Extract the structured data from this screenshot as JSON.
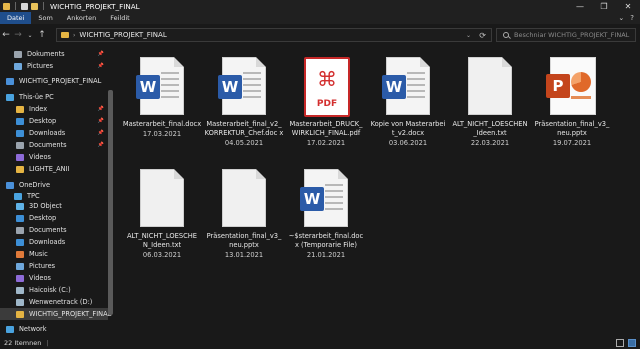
{
  "window": {
    "title": "WICHTIG_PROJEKT_FINAL",
    "minimize": "—",
    "maximize": "❐",
    "close": "✕"
  },
  "ribbon": {
    "tabs": [
      "Datei",
      "Som",
      "Ankorten",
      "Feildit"
    ],
    "help": "?"
  },
  "address": {
    "path": "WICHTIG_PROJEKT_FINAL",
    "search_placeholder": "Beschniar WICHTIG_PROJEKT_FINAL"
  },
  "sidebar": {
    "items": [
      {
        "label": "Dokuments",
        "icon": "documents-icon",
        "color": "#9aa3ad",
        "pinned": true
      },
      {
        "label": "Pictures",
        "icon": "pictures-icon",
        "color": "#6fa8dc",
        "pinned": true
      },
      {
        "label": "WICHTIG_PROJEKT_FINAL",
        "icon": "cloud-icon",
        "color": "#4a90d9",
        "pinned": false
      },
      {
        "label": "This-üe PC",
        "icon": "pc-icon",
        "color": "#4aa3df",
        "pinned": false
      },
      {
        "label": "Index",
        "icon": "folder-icon",
        "color": "#e5b443",
        "pinned": true
      },
      {
        "label": "Desktop",
        "icon": "desktop-icon",
        "color": "#3d8fd6",
        "pinned": true
      },
      {
        "label": "Downloads",
        "icon": "downloads-icon",
        "color": "#3d8fd6",
        "pinned": true
      },
      {
        "label": "Documents",
        "icon": "documents-icon",
        "color": "#9aa3ad",
        "pinned": true
      },
      {
        "label": "Videos",
        "icon": "videos-icon",
        "color": "#8e6bd8",
        "pinned": false
      },
      {
        "label": "LIGHTE_ANII",
        "icon": "folder-icon",
        "color": "#e5b443",
        "pinned": false
      },
      {
        "label": "OneDrive",
        "icon": "cloud-icon",
        "color": "#4a90d9",
        "pinned": false
      },
      {
        "label": "TPC",
        "icon": "pc-icon",
        "color": "#4aa3df",
        "pinned": false
      },
      {
        "label": "3D Object",
        "icon": "3d-object-icon",
        "color": "#5fb3e8",
        "pinned": false
      },
      {
        "label": "Desktop",
        "icon": "desktop-icon",
        "color": "#3d8fd6",
        "pinned": false
      },
      {
        "label": "Documents",
        "icon": "documents-icon",
        "color": "#9aa3ad",
        "pinned": false
      },
      {
        "label": "Downloads",
        "icon": "downloads-icon",
        "color": "#3d8fd6",
        "pinned": false
      },
      {
        "label": "Music",
        "icon": "music-icon",
        "color": "#e07a3a",
        "pinned": false
      },
      {
        "label": "Pictures",
        "icon": "pictures-icon",
        "color": "#6fa8dc",
        "pinned": false
      },
      {
        "label": "Videos",
        "icon": "videos-icon",
        "color": "#8e6bd8",
        "pinned": false
      },
      {
        "label": "Haicoisk (C:)",
        "icon": "drive-icon",
        "color": "#9fb7c9",
        "pinned": false
      },
      {
        "label": "Wenwenetrack (D:)",
        "icon": "drive-icon",
        "color": "#9fb7c9",
        "pinned": false
      },
      {
        "label": "WICHTIG_PROJEKT_FINAL",
        "icon": "folder-icon",
        "color": "#e5b443",
        "pinned": false
      },
      {
        "label": "Network",
        "icon": "network-icon",
        "color": "#4aa3df",
        "pinned": false
      }
    ]
  },
  "files": [
    {
      "name": "Masterarbeit_final.docx",
      "date": "17.03.2021",
      "type": "word"
    },
    {
      "name": "Masterarbeit_final_v2_ KORREKTUR_Chef.doc x",
      "date": "04.05.2021",
      "type": "word"
    },
    {
      "name": "Masterarbeit_DRUCK_ WIRKLICH_FINAL.pdf",
      "date": "17.02.2021",
      "type": "pdf"
    },
    {
      "name": "Kopie von Masterarbei t_v2.docx",
      "date": "03.06.2021",
      "type": "word"
    },
    {
      "name": "ALT_NICHT_LOESCHEN _Ideen.txt",
      "date": "22.03.2021",
      "type": "txt"
    },
    {
      "name": "Präsentation_final_v3_ neu.pptx",
      "date": "19.07.2021",
      "type": "ppt"
    },
    {
      "name": "ALT_NICHT_LOESCHE N_Ideen.txt",
      "date": "06.03.2021",
      "type": "txt"
    },
    {
      "name": "Präsentation_final_v3_ neu.pptx",
      "date": "13.01.2021",
      "type": "txt"
    },
    {
      "name": "~$sterarbeit_final.doc x (Temporarie File)",
      "date": "21.01.2021",
      "type": "word"
    }
  ],
  "status": {
    "count": "22 Itemnen",
    "icons": {
      "details": "details-view-icon",
      "tiles": "large-icons-view-icon"
    }
  },
  "colors": {
    "background": "#191919",
    "accent": "#1f4e8c",
    "word": "#2b5ba8",
    "pdf": "#d32f2f",
    "ppt": "#c4451c"
  }
}
